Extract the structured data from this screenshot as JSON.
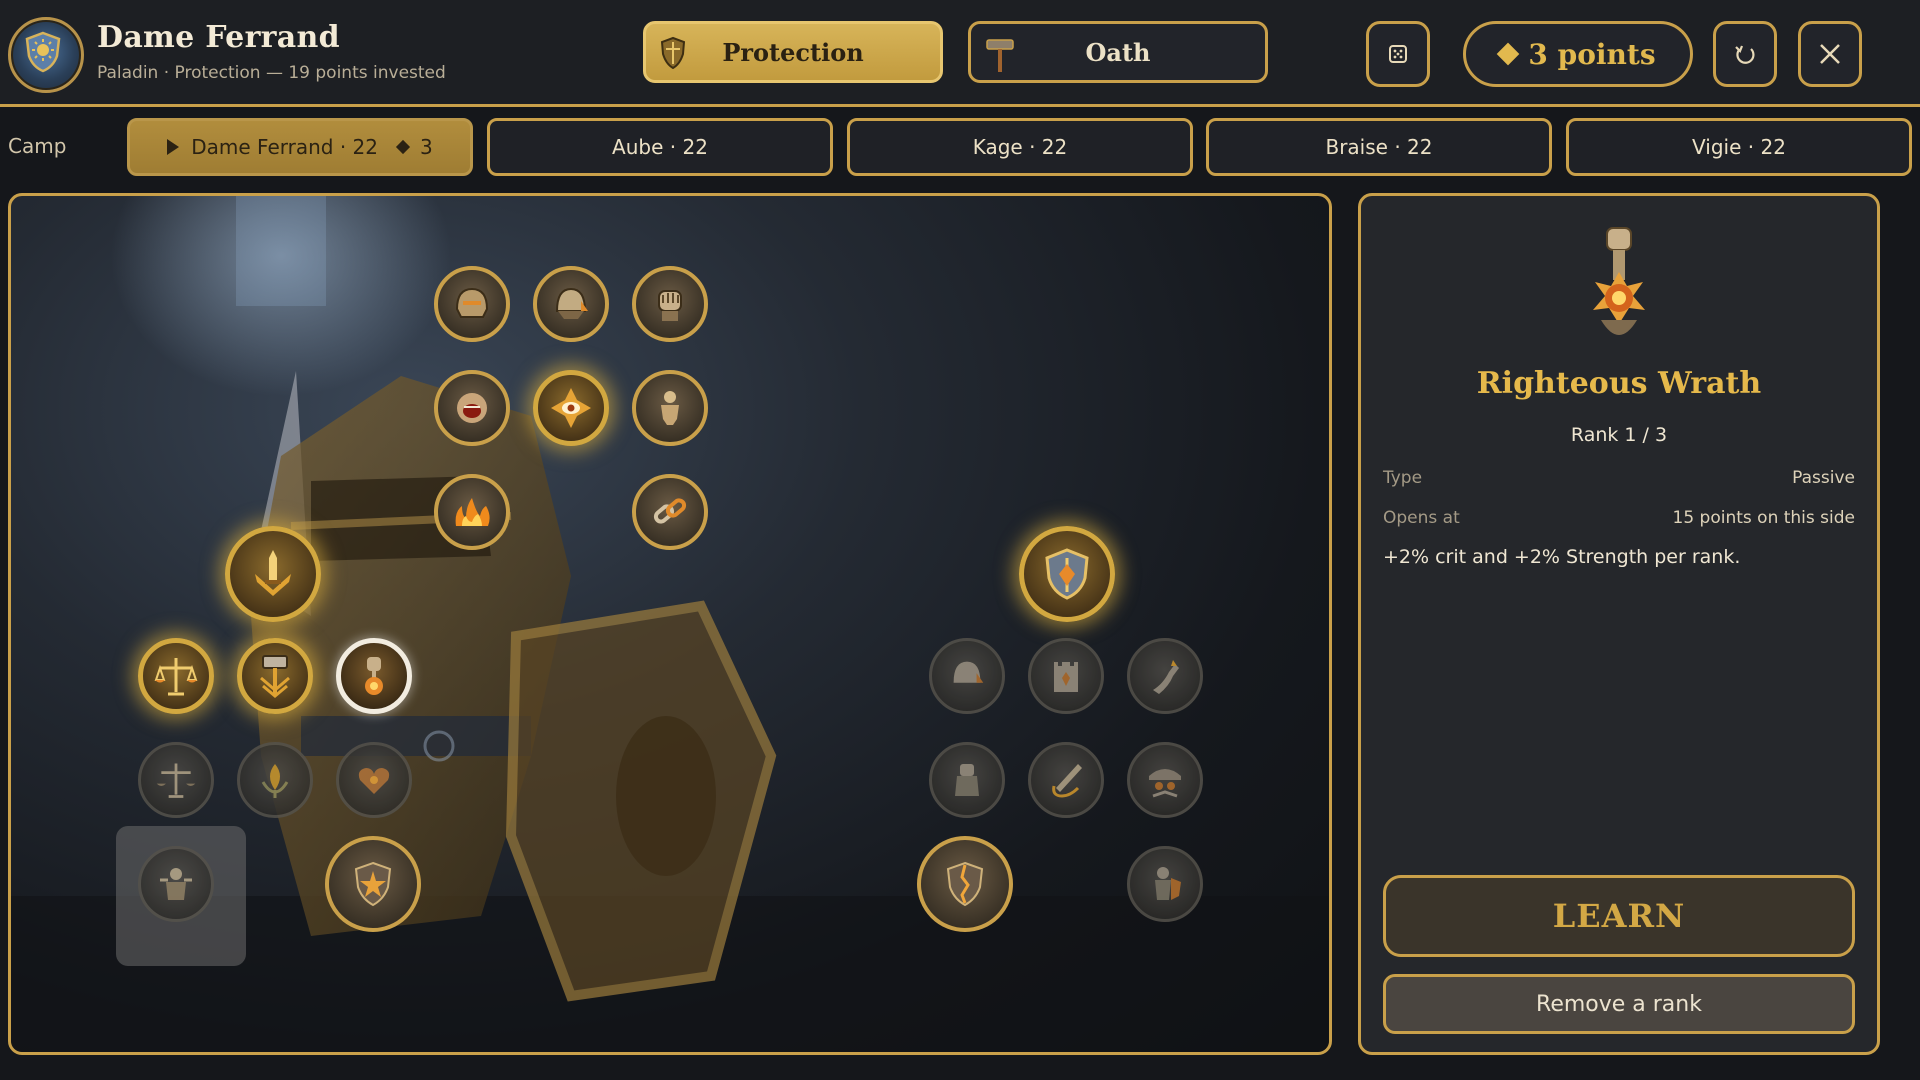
{
  "header": {
    "character_name": "Dame Ferrand",
    "character_subtitle": "Paladin · Protection — 19 points invested",
    "spec_tabs": [
      {
        "label": "Protection",
        "icon": "shield-icon",
        "active": true
      },
      {
        "label": "Oath",
        "icon": "hammer-icon",
        "active": false
      }
    ],
    "points_label": "3 points",
    "buttons": {
      "randomize_icon": "dice-icon",
      "reset_icon": "undo-icon",
      "close_icon": "close-icon"
    }
  },
  "party": {
    "label": "Camp",
    "members": [
      {
        "name": "Dame Ferrand · 22",
        "points": "3",
        "active": true
      },
      {
        "name": "Aube · 22",
        "active": false
      },
      {
        "name": "Kage · 22",
        "active": false
      },
      {
        "name": "Braise · 22",
        "active": false
      },
      {
        "name": "Vigie · 22",
        "active": false
      }
    ]
  },
  "tree": {
    "nodes": [
      {
        "id": "helm-crest",
        "icon": "helm-icon",
        "state": "available"
      },
      {
        "id": "steel-helm",
        "icon": "helmet-icon",
        "state": "available"
      },
      {
        "id": "gauntlet",
        "icon": "gauntlet-icon",
        "state": "available"
      },
      {
        "id": "war-cry",
        "icon": "shout-icon",
        "state": "available"
      },
      {
        "id": "vigilant-eye",
        "icon": "eye-icon",
        "state": "learned"
      },
      {
        "id": "bulwark-body",
        "icon": "figure-icon",
        "state": "available"
      },
      {
        "id": "sacred-fire",
        "icon": "flames-icon",
        "state": "available"
      },
      {
        "id": "chains",
        "icon": "chain-icon",
        "state": "available"
      },
      {
        "id": "radiant-sword",
        "icon": "sword-icon",
        "state": "learned"
      },
      {
        "id": "balance",
        "icon": "scales-icon",
        "state": "learned"
      },
      {
        "id": "hammer-blessing",
        "icon": "hammer-icon",
        "state": "learned"
      },
      {
        "id": "righteous-wrath",
        "icon": "fist-icon",
        "state": "selected"
      },
      {
        "id": "balance-2",
        "icon": "scales-icon",
        "state": "locked"
      },
      {
        "id": "sprout",
        "icon": "leaf-icon",
        "state": "locked"
      },
      {
        "id": "burning-heart",
        "icon": "heart-icon",
        "state": "locked"
      },
      {
        "id": "guardian",
        "icon": "knight-icon",
        "state": "locked"
      },
      {
        "id": "star-shield",
        "icon": "shield-star-icon",
        "state": "available"
      },
      {
        "id": "aegis",
        "icon": "shield-icon",
        "state": "learned"
      },
      {
        "id": "visor",
        "icon": "helmet-icon",
        "state": "locked"
      },
      {
        "id": "tower",
        "icon": "tower-icon",
        "state": "locked"
      },
      {
        "id": "rising-arm",
        "icon": "arm-icon",
        "state": "locked"
      },
      {
        "id": "stone-fist",
        "icon": "fist-icon",
        "state": "locked"
      },
      {
        "id": "blade-sweep",
        "icon": "blade-icon",
        "state": "locked"
      },
      {
        "id": "cover",
        "icon": "group-icon",
        "state": "locked"
      },
      {
        "id": "shattered-shield",
        "icon": "cracked-shield-icon",
        "state": "available"
      },
      {
        "id": "stalwart",
        "icon": "warrior-icon",
        "state": "locked"
      }
    ]
  },
  "detail": {
    "icon": "fist-icon",
    "title": "Righteous Wrath",
    "rank": "Rank 1 / 3",
    "rows": [
      {
        "label": "Type",
        "value": "Passive"
      },
      {
        "label": "Opens at",
        "value": "15 points on this side"
      }
    ],
    "description": "+2% crit and +2% Strength per rank.",
    "learn_label": "LEARN",
    "remove_label": "Remove a rank"
  },
  "colors": {
    "accent": "#c9a04a",
    "gold_text": "#e2b94e",
    "panel": "#25272b",
    "background": "#15171b"
  }
}
